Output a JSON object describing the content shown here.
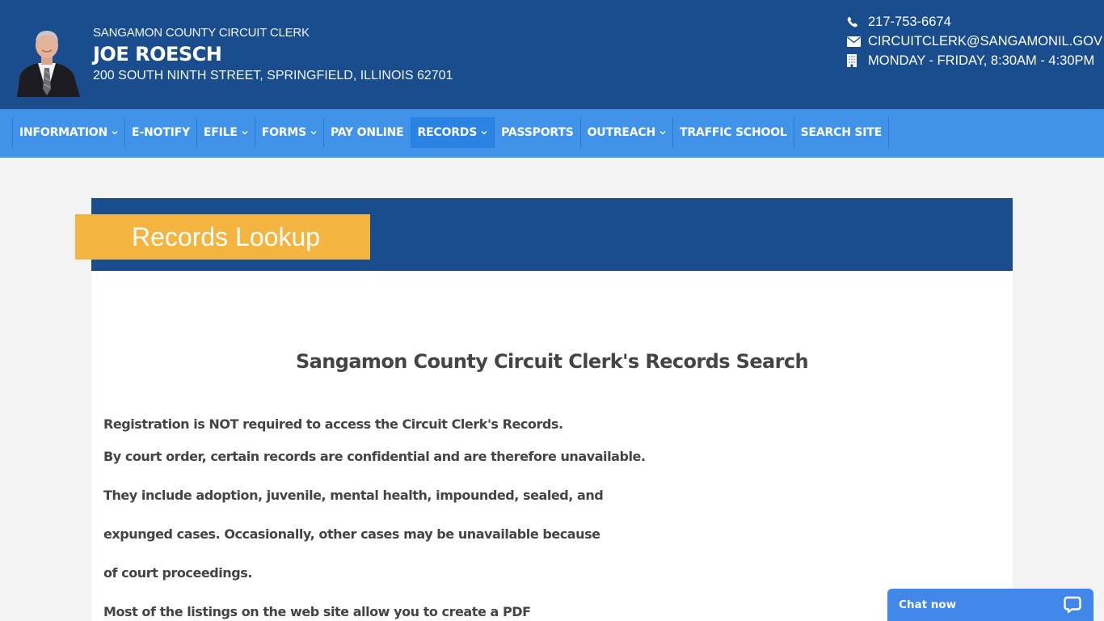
{
  "header": {
    "office": "SANGAMON COUNTY CIRCUIT CLERK",
    "name": "JOE ROESCH",
    "address": "200 SOUTH NINTH STREET, SPRINGFIELD, ILLINOIS 62701",
    "portrait_alt": "Joe Roesch portrait",
    "contact": {
      "phone": {
        "icon": "phone-icon",
        "text": "217-753-6674"
      },
      "email": {
        "icon": "envelope-icon",
        "text": "CIRCUITCLERK@SANGAMONIL.GOV"
      },
      "hours": {
        "icon": "building-icon",
        "text": "MONDAY - FRIDAY, 8:30AM - 4:30PM"
      }
    }
  },
  "nav": {
    "items": [
      {
        "label": "INFORMATION",
        "dropdown": true
      },
      {
        "label": "E-NOTIFY",
        "dropdown": false
      },
      {
        "label": "EFILE",
        "dropdown": true
      },
      {
        "label": "FORMS",
        "dropdown": true
      },
      {
        "label": "PAY ONLINE",
        "dropdown": false
      },
      {
        "label": "RECORDS",
        "dropdown": true,
        "active": true
      },
      {
        "label": "PASSPORTS",
        "dropdown": false
      },
      {
        "label": "OUTREACH",
        "dropdown": true
      },
      {
        "label": "TRAFFIC SCHOOL",
        "dropdown": false
      },
      {
        "label": "SEARCH SITE",
        "dropdown": false
      }
    ]
  },
  "page": {
    "title": "Records Lookup",
    "heading": "Sangamon County Circuit Clerk's Records Search",
    "paragraphs": [
      "Registration is NOT required to access the Circuit Clerk's Records.",
      "By court order, certain records are confidential and are therefore unavailable.",
      "They include adoption, juvenile, mental health, impounded, sealed, and",
      "expunged cases. Occasionally, other cases may be unavailable because",
      "of court proceedings.",
      "Most of the listings on the web site allow you to create a PDF"
    ]
  },
  "chat": {
    "label": "Chat now",
    "icon": "chat-bubble-icon"
  },
  "colors": {
    "header_bg": "#1a4d8d",
    "nav_bg": "#4093e8",
    "nav_active": "#2a82e2",
    "title_tab": "#f3b53f",
    "chat_bg": "#4187e8",
    "text": "#444444"
  }
}
